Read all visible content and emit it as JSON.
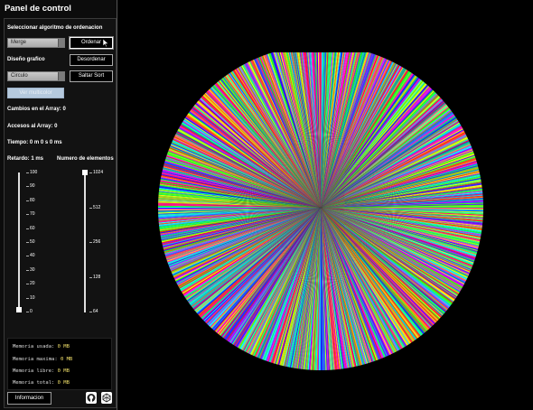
{
  "panel": {
    "title": "Panel de control",
    "algo_label": "Seleccionar algoritmo de ordenacion",
    "algo_value": "Merge",
    "sort_button": "Ordenar",
    "design_label": "Diseño grafico",
    "shuffle_button": "Desordenar",
    "design_value": "Circulo",
    "skip_button": "Saltar Sort",
    "multicolor_button": "Ver multicolor",
    "stats": {
      "changes": "Cambios en el Array: 0",
      "accesses": "Accesos al Array: 0",
      "time": "Tiempo: 0 m 0 s 0 ms"
    },
    "delay_label": "Retardo: 1 ms",
    "count_label": "Numero de elementos",
    "delay_ticks": [
      "100",
      "90",
      "80",
      "70",
      "60",
      "50",
      "40",
      "30",
      "20",
      "10",
      "0"
    ],
    "delay_value": 1,
    "count_ticks": [
      "1024",
      "512",
      "256",
      "128",
      "64"
    ],
    "count_value": "1024",
    "memory": [
      {
        "k": "Memoria usada:",
        "v": "0 MB"
      },
      {
        "k": "Memoria maxima:",
        "v": "0 MB"
      },
      {
        "k": "Memoria libre:",
        "v": "0 MB"
      },
      {
        "k": "Memoria total:",
        "v": "0 MB"
      }
    ],
    "info_button": "Informacion",
    "icons": [
      "github-icon",
      "codepen-icon"
    ]
  },
  "visualization": {
    "type": "circle",
    "elements": 1024
  }
}
